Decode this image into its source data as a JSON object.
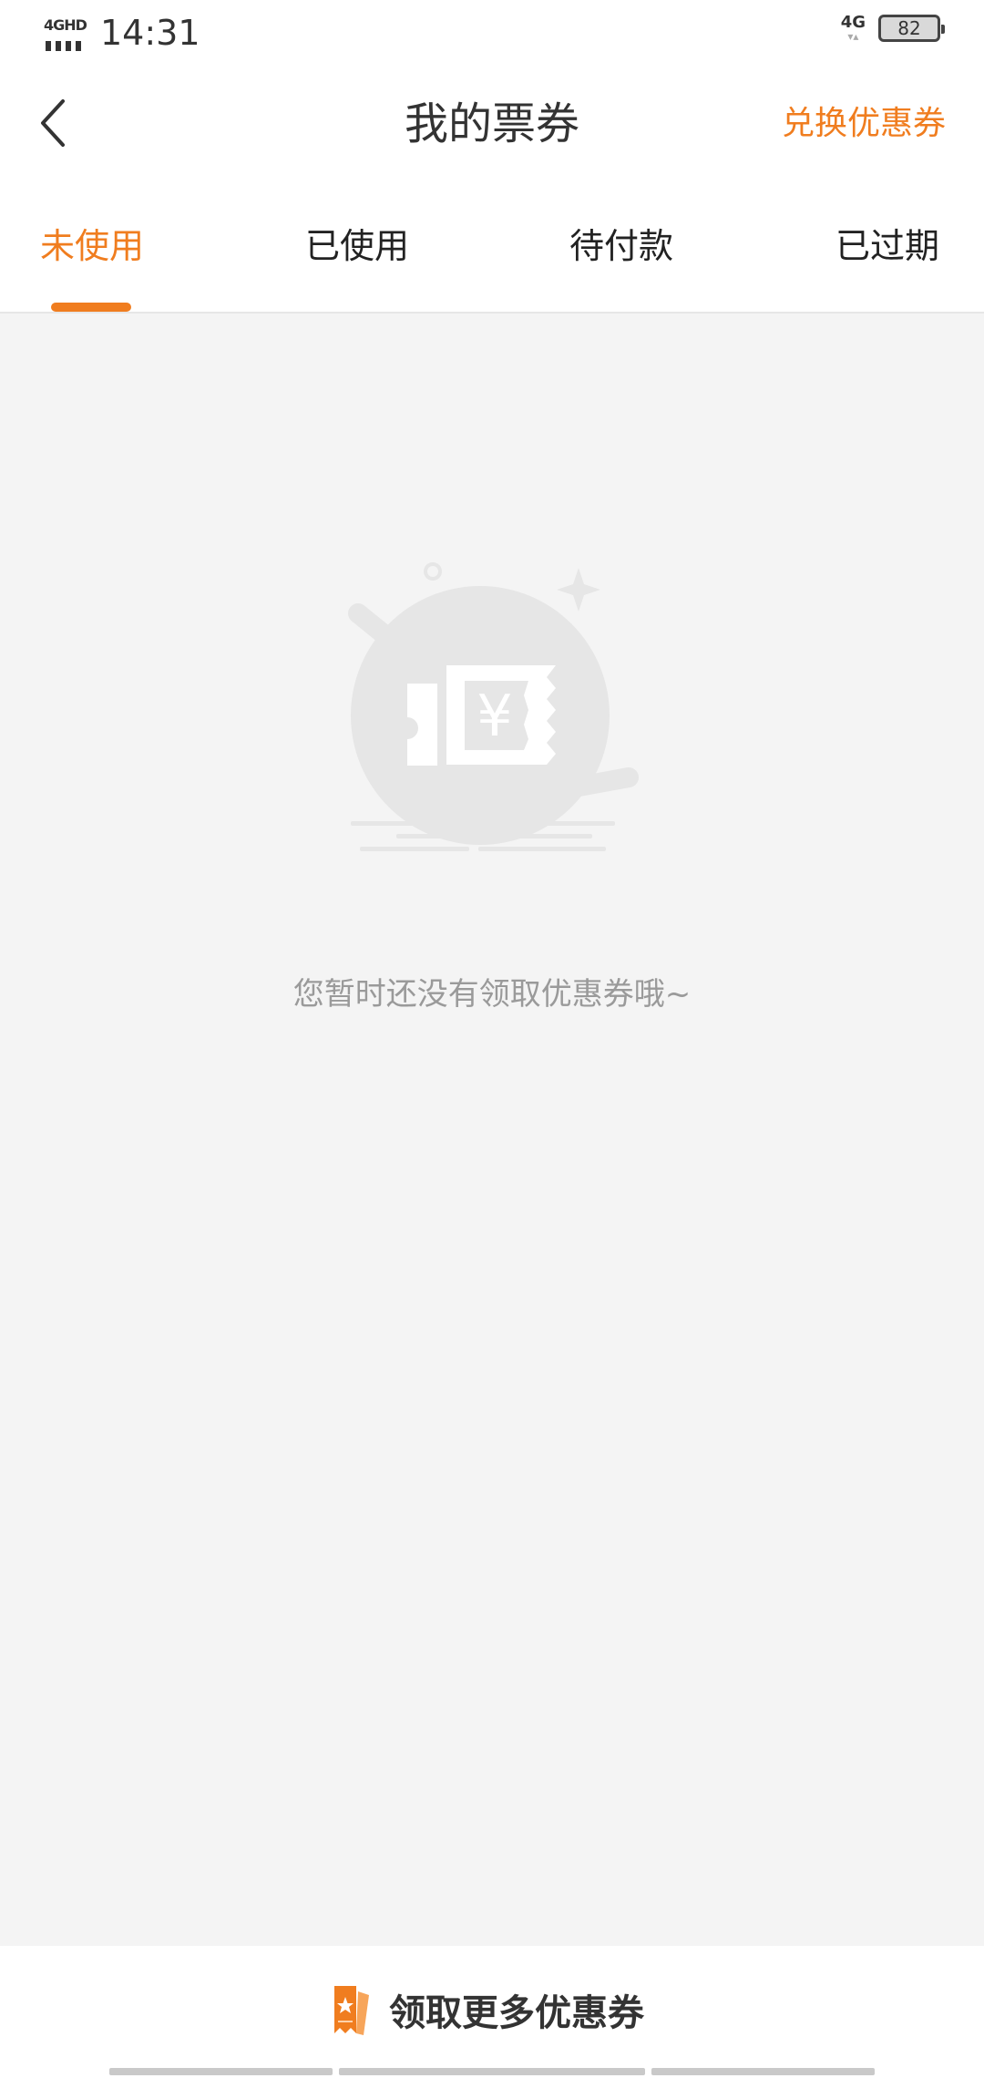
{
  "status_bar": {
    "network_left": "4GHD",
    "time": "14:31",
    "network_right": "4G",
    "battery": "82"
  },
  "header": {
    "title": "我的票券",
    "redeem_label": "兑换优惠券",
    "back_icon": "chevron-left-icon"
  },
  "tabs": [
    {
      "label": "未使用",
      "active": true
    },
    {
      "label": "已使用",
      "active": false
    },
    {
      "label": "待付款",
      "active": false
    },
    {
      "label": "已过期",
      "active": false
    }
  ],
  "empty_state": {
    "icon": "coupon-yen-icon",
    "message": "您暂时还没有领取优惠券哦~"
  },
  "bottom": {
    "get_more_label": "领取更多优惠券",
    "icon": "ticket-star-icon"
  },
  "colors": {
    "accent": "#f07d1f",
    "background": "#f4f4f4",
    "muted_text": "#9a9a9a"
  }
}
